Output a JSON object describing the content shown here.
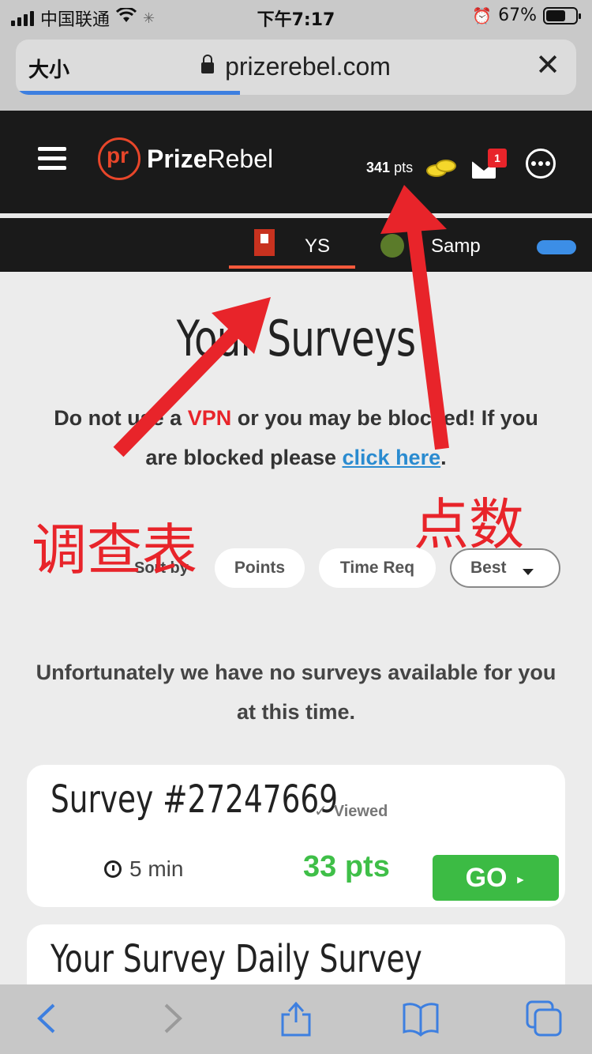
{
  "status_bar": {
    "carrier": "中国联通",
    "time": "下午7:17",
    "battery": "67%"
  },
  "browser": {
    "text_size_label": "大小",
    "url": "prizerebel.com",
    "load_progress": 0.4
  },
  "site": {
    "logo_mark": "pr",
    "logo_prize": "Prize",
    "logo_rebel": "Rebel",
    "points_value": "341",
    "points_unit": "pts",
    "mail_badge": "1"
  },
  "tabs": {
    "surveys_label": "YS",
    "samples_label": "Samp"
  },
  "main": {
    "title": "Your Surveys",
    "notice": {
      "before_vpn": "Do not use a ",
      "vpn": "VPN",
      "after_vpn": " or you may be blocked! If you are blocked please ",
      "link": "click here",
      "end": "."
    },
    "sort": {
      "label": "Sort by",
      "options": [
        "Points",
        "Time Req",
        "Best"
      ]
    },
    "empty_message": "Unfortunately we have no surveys available for you at this time.",
    "cards": [
      {
        "title": "Survey #27247669",
        "status": "Viewed",
        "time": "5 min",
        "points": "33 pts",
        "go": "GO"
      },
      {
        "title": "Your Survey Daily Survey"
      }
    ]
  },
  "annotations": {
    "surveys_note": "调查表",
    "points_note": "点数",
    "color": "#e8242a"
  },
  "colors": {
    "header_bg": "#1a1a1a",
    "brand": "#e8462a",
    "points_green": "#3fbf48",
    "link_blue": "#2a8bd0"
  }
}
